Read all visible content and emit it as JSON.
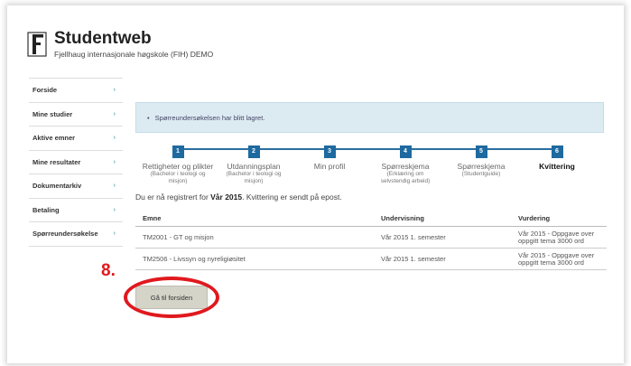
{
  "header": {
    "title": "Studentweb",
    "subtitle": "Fjellhaug internasjonale høgskole (FIH) DEMO"
  },
  "sidebar": {
    "items": [
      {
        "label": "Forside"
      },
      {
        "label": "Mine studier"
      },
      {
        "label": "Aktive emner"
      },
      {
        "label": "Mine resultater"
      },
      {
        "label": "Dokumentarkiv"
      },
      {
        "label": "Betaling"
      },
      {
        "label": "Spørreundersøkelse"
      }
    ],
    "chevron": "›"
  },
  "alert": {
    "bullet": "•",
    "text": "Spørreundersøkelsen har blitt lagret."
  },
  "steps": [
    {
      "num": "1",
      "title": "Rettigheter og plikter",
      "sub1": "(Bachelor i teologi og",
      "sub2": "misjon)"
    },
    {
      "num": "2",
      "title": "Utdanningsplan",
      "sub1": "(Bachelor i teologi og",
      "sub2": "misjon)"
    },
    {
      "num": "3",
      "title": "Min profil",
      "sub1": "",
      "sub2": ""
    },
    {
      "num": "4",
      "title": "Spørreskjema",
      "sub1": "(Erklæring om",
      "sub2": "selvstendig arbeid)"
    },
    {
      "num": "5",
      "title": "Spørreskjema",
      "sub1": "(Studentguide)",
      "sub2": ""
    },
    {
      "num": "6",
      "title": "Kvittering",
      "sub1": "",
      "sub2": ""
    }
  ],
  "confirmation": {
    "prefix": "Du er nå registrert for ",
    "semester": "Vår 2015",
    "suffix": ". Kvittering er sendt på epost."
  },
  "table": {
    "headers": [
      "Emne",
      "Undervisning",
      "Vurdering"
    ],
    "rows": [
      {
        "emne": "TM2001 - GT og misjon",
        "undervisning": "Vår 2015 1. semester",
        "vurdering1": "Vår 2015 - Oppgave over",
        "vurdering2": "oppgitt tema 3000 ord"
      },
      {
        "emne": "TM2506 - Livssyn og nyreligiøsitet",
        "undervisning": "Vår 2015 1. semester",
        "vurdering1": "Vår 2015 - Oppgave over",
        "vurdering2": "oppgitt tema 3000 ord"
      }
    ]
  },
  "annotation": {
    "number": "8."
  },
  "home_button": {
    "label": "Gå til forsiden"
  },
  "colors": {
    "accent": "#1e6aa0",
    "annotation": "#e0191e",
    "alert_bg": "#dcebf2"
  }
}
